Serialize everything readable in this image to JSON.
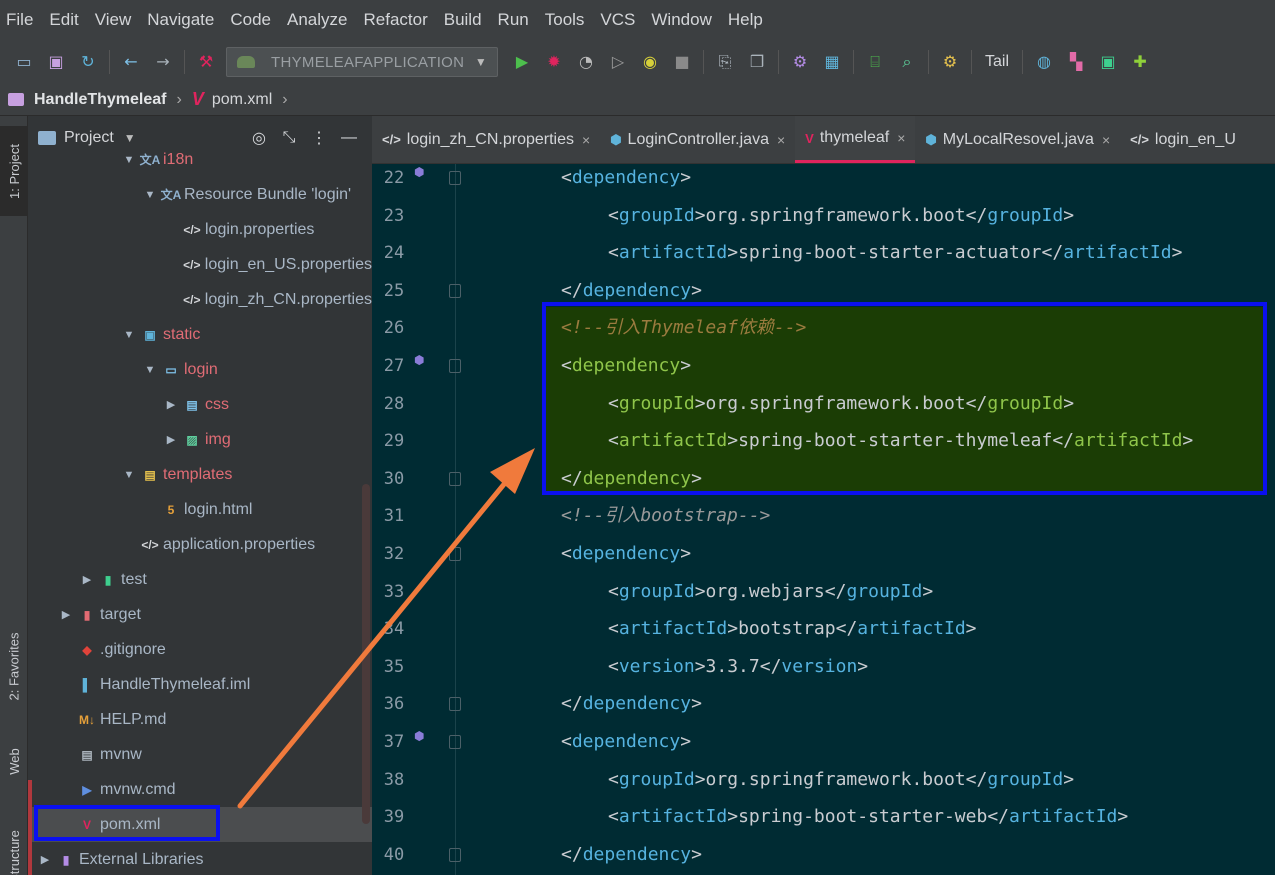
{
  "menu": [
    "File",
    "Edit",
    "View",
    "Navigate",
    "Code",
    "Analyze",
    "Refactor",
    "Build",
    "Run",
    "Tools",
    "VCS",
    "Window",
    "Help"
  ],
  "toolbar": {
    "run_config": "THYMELEAFAPPLICATION",
    "tail_label": "Tail"
  },
  "breadcrumb": {
    "project": "HandleThymeleaf",
    "file": "pom.xml"
  },
  "side_tabs": {
    "project": "1: Project",
    "favorites": "2: Favorites",
    "web": "Web",
    "structure": "Structure"
  },
  "project_panel": {
    "title": "Project",
    "tree": [
      {
        "label": "i18n",
        "indent": 3,
        "arrow": "v",
        "icon": "resource",
        "color": "red"
      },
      {
        "label": "Resource Bundle 'login'",
        "indent": 4,
        "arrow": "v",
        "icon": "resource",
        "color": "norm"
      },
      {
        "label": "login.properties",
        "indent": 5,
        "arrow": "",
        "icon": "props",
        "color": "norm"
      },
      {
        "label": "login_en_US.properties",
        "indent": 5,
        "arrow": "",
        "icon": "props",
        "color": "norm"
      },
      {
        "label": "login_zh_CN.properties",
        "indent": 5,
        "arrow": "",
        "icon": "props",
        "color": "norm"
      },
      {
        "label": "static",
        "indent": 3,
        "arrow": "v",
        "icon": "web-folder",
        "color": "red"
      },
      {
        "label": "login",
        "indent": 4,
        "arrow": "v",
        "icon": "folder",
        "color": "red"
      },
      {
        "label": "css",
        "indent": 5,
        "arrow": ">",
        "icon": "css-folder",
        "color": "red"
      },
      {
        "label": "img",
        "indent": 5,
        "arrow": ">",
        "icon": "img-folder",
        "color": "red"
      },
      {
        "label": "templates",
        "indent": 3,
        "arrow": "v",
        "icon": "tpl-folder",
        "color": "red"
      },
      {
        "label": "login.html",
        "indent": 4,
        "arrow": "",
        "icon": "html",
        "color": "norm"
      },
      {
        "label": "application.properties",
        "indent": 3,
        "arrow": "",
        "icon": "props",
        "color": "norm"
      },
      {
        "label": "test",
        "indent": 1,
        "arrow": ">",
        "icon": "test-folder",
        "color": "norm"
      },
      {
        "label": "target",
        "indent": 0,
        "arrow": ">",
        "icon": "target-folder",
        "color": "norm"
      },
      {
        "label": ".gitignore",
        "indent": 0,
        "arrow": "",
        "icon": "git",
        "color": "norm"
      },
      {
        "label": "HandleThymeleaf.iml",
        "indent": 0,
        "arrow": "",
        "icon": "iml",
        "color": "norm"
      },
      {
        "label": "HELP.md",
        "indent": 0,
        "arrow": "",
        "icon": "md",
        "color": "norm"
      },
      {
        "label": "mvnw",
        "indent": 0,
        "arrow": "",
        "icon": "file",
        "color": "norm"
      },
      {
        "label": "mvnw.cmd",
        "indent": 0,
        "arrow": "",
        "icon": "cmd",
        "color": "norm"
      },
      {
        "label": "pom.xml",
        "indent": 0,
        "arrow": "",
        "icon": "maven",
        "color": "norm",
        "selected": true
      },
      {
        "label": "External Libraries",
        "indent": -1,
        "arrow": ">",
        "icon": "libs",
        "color": "norm"
      }
    ]
  },
  "tabs": [
    {
      "label": "login_zh_CN.properties",
      "icon": "props",
      "active": false
    },
    {
      "label": "LoginController.java",
      "icon": "java",
      "active": false
    },
    {
      "label": "thymeleaf",
      "icon": "maven",
      "active": true
    },
    {
      "label": "MyLocalResovel.java",
      "icon": "java",
      "active": false
    },
    {
      "label": "login_en_U",
      "icon": "props",
      "active": false
    }
  ],
  "code_lines": [
    {
      "n": "22",
      "indent": 1,
      "kind": "open",
      "tag": "dependency",
      "mark": true
    },
    {
      "n": "23",
      "indent": 2,
      "kind": "elem",
      "tag": "groupId",
      "text": "org.springframework.boot"
    },
    {
      "n": "24",
      "indent": 2,
      "kind": "elem",
      "tag": "artifactId",
      "text": "spring-boot-starter-actuator"
    },
    {
      "n": "25",
      "indent": 1,
      "kind": "close",
      "tag": "dependency"
    },
    {
      "n": "26",
      "indent": 1,
      "kind": "comment",
      "text": "<!--引入Thymeleaf依赖-->"
    },
    {
      "n": "27",
      "indent": 1,
      "kind": "open",
      "tag": "dependency",
      "mark": true
    },
    {
      "n": "28",
      "indent": 2,
      "kind": "elem",
      "tag": "groupId",
      "text": "org.springframework.boot"
    },
    {
      "n": "29",
      "indent": 2,
      "kind": "elem",
      "tag": "artifactId",
      "text": "spring-boot-starter-thymeleaf"
    },
    {
      "n": "30",
      "indent": 1,
      "kind": "close",
      "tag": "dependency"
    },
    {
      "n": "31",
      "indent": 1,
      "kind": "comment",
      "text": "<!--引入bootstrap-->"
    },
    {
      "n": "32",
      "indent": 1,
      "kind": "open",
      "tag": "dependency"
    },
    {
      "n": "33",
      "indent": 2,
      "kind": "elem",
      "tag": "groupId",
      "text": "org.webjars"
    },
    {
      "n": "34",
      "indent": 2,
      "kind": "elem",
      "tag": "artifactId",
      "text": "bootstrap"
    },
    {
      "n": "35",
      "indent": 2,
      "kind": "elem",
      "tag": "version",
      "text": "3.3.7"
    },
    {
      "n": "36",
      "indent": 1,
      "kind": "close",
      "tag": "dependency"
    },
    {
      "n": "37",
      "indent": 1,
      "kind": "open",
      "tag": "dependency",
      "mark": true
    },
    {
      "n": "38",
      "indent": 2,
      "kind": "elem",
      "tag": "groupId",
      "text": "org.springframework.boot"
    },
    {
      "n": "39",
      "indent": 2,
      "kind": "elem",
      "tag": "artifactId",
      "text": "spring-boot-starter-web"
    },
    {
      "n": "40",
      "indent": 1,
      "kind": "close",
      "tag": "dependency"
    }
  ],
  "colors": {
    "highlight_box": "#0b10f0",
    "arrow": "#f07a3c",
    "active_tab_underline": "#e0245e",
    "editor_bg": "#002b33",
    "highlight_block_bg": "#1b3d05"
  }
}
